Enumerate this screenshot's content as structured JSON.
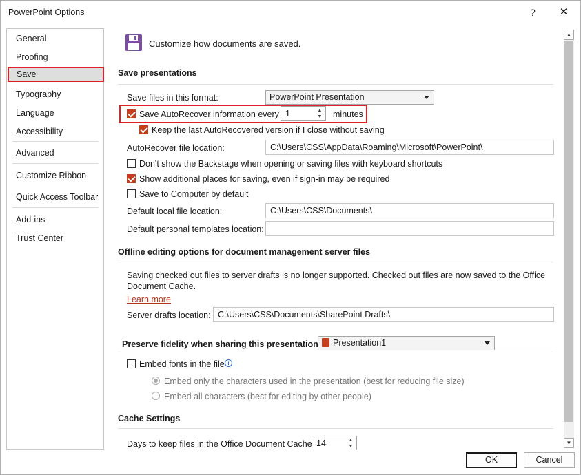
{
  "window": {
    "title": "PowerPoint Options",
    "help": "?",
    "close": "✕"
  },
  "sidebar": {
    "items": [
      {
        "label": "General"
      },
      {
        "label": "Proofing"
      },
      {
        "label": "Save"
      },
      {
        "label": "Typography"
      },
      {
        "label": "Language"
      },
      {
        "label": "Accessibility"
      },
      {
        "label": "Advanced"
      },
      {
        "label": "Customize Ribbon"
      },
      {
        "label": "Quick Access Toolbar"
      },
      {
        "label": "Add-ins"
      },
      {
        "label": "Trust Center"
      }
    ],
    "selected": "Save"
  },
  "header": {
    "text": "Customize how documents are saved."
  },
  "save_presentations": {
    "heading": "Save presentations",
    "format_label": "Save files in this format:",
    "format_value": "PowerPoint Presentation",
    "autorecover_label": "Save AutoRecover information every",
    "autorecover_value": "1",
    "autorecover_unit": "minutes",
    "keep_last_label": "Keep the last AutoRecovered version if I close without saving",
    "autorecover_location_label": "AutoRecover file location:",
    "autorecover_location_value": "C:\\Users\\CSS\\AppData\\Roaming\\Microsoft\\PowerPoint\\",
    "dont_show_backstage_label": "Don't show the Backstage when opening or saving files with keyboard shortcuts",
    "show_additional_label": "Show additional places for saving, even if sign-in may be required",
    "save_to_computer_label": "Save to Computer by default",
    "default_local_label": "Default local file location:",
    "default_local_value": "C:\\Users\\CSS\\Documents\\",
    "default_templates_label": "Default personal templates location:",
    "default_templates_value": ""
  },
  "offline": {
    "heading": "Offline editing options for document management server files",
    "description_line1": "Saving checked out files to server drafts is no longer supported. Checked out files are now saved to the Office",
    "description_line2": "Document Cache.",
    "learn_more": "Learn more",
    "server_drafts_label": "Server drafts location:",
    "server_drafts_value": "C:\\Users\\CSS\\Documents\\SharePoint Drafts\\"
  },
  "fidelity": {
    "heading": "Preserve fidelity when sharing this presentation:",
    "presentation_value": "Presentation1",
    "embed_fonts_label": "Embed fonts in the file",
    "embed_only_label": "Embed only the characters used in the presentation (best for reducing file size)",
    "embed_all_label": "Embed all characters (best for editing by other people)"
  },
  "cache": {
    "heading": "Cache Settings",
    "days_label": "Days to keep files in the Office Document Cache:",
    "days_value": "14"
  },
  "footer": {
    "ok": "OK",
    "cancel": "Cancel"
  },
  "colors": {
    "accent": "#c43e1c",
    "highlight_box": "#e01f26",
    "save_icon": "#7b4fa0"
  }
}
